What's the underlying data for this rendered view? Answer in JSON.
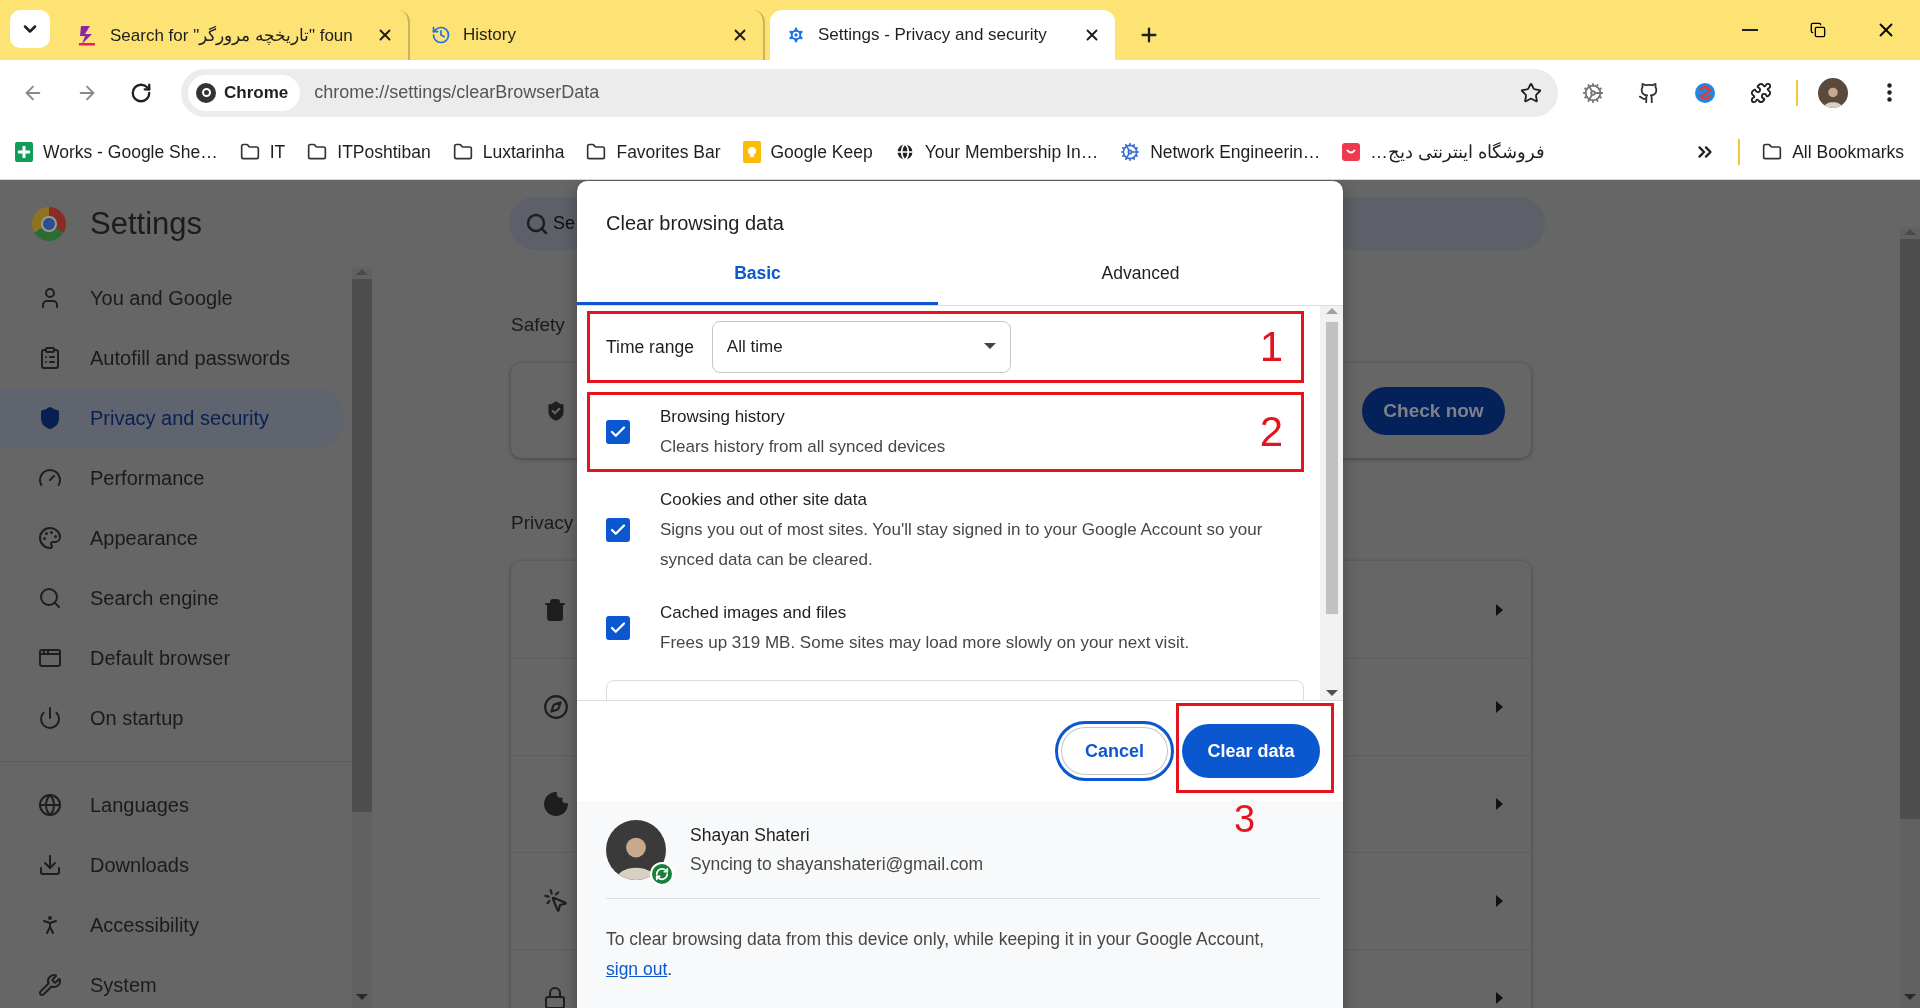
{
  "browser_tabs": [
    {
      "title": "Search for \"تاریخچه مرورگر\" foun",
      "selected": false
    },
    {
      "title": "History",
      "selected": false
    },
    {
      "title": "Settings - Privacy and security",
      "selected": true
    }
  ],
  "address_bar": {
    "chip": "Chrome",
    "url": "chrome://settings/clearBrowserData"
  },
  "bookmarks": [
    {
      "label": "Works - Google She…"
    },
    {
      "label": "IT"
    },
    {
      "label": "ITPoshtiban"
    },
    {
      "label": "Luxtarinha"
    },
    {
      "label": "Favorites Bar"
    },
    {
      "label": "Google Keep"
    },
    {
      "label": "Your Membership In…"
    },
    {
      "label": "Network Engineerin…"
    },
    {
      "label": "فروشگاه اینترنتی دیج…"
    }
  ],
  "all_bookmarks": "All Bookmarks",
  "settings": {
    "title": "Settings",
    "search_placeholder": "Se",
    "nav_groups": [
      {
        "items": [
          {
            "label": "You and Google",
            "selected": false
          },
          {
            "label": "Autofill and passwords",
            "selected": false
          },
          {
            "label": "Privacy and security",
            "selected": true
          },
          {
            "label": "Performance",
            "selected": false
          },
          {
            "label": "Appearance",
            "selected": false
          },
          {
            "label": "Search engine",
            "selected": false
          },
          {
            "label": "Default browser",
            "selected": false
          },
          {
            "label": "On startup",
            "selected": false
          }
        ]
      },
      {
        "items": [
          {
            "label": "Languages",
            "selected": false
          },
          {
            "label": "Downloads",
            "selected": false
          },
          {
            "label": "Accessibility",
            "selected": false
          },
          {
            "label": "System",
            "selected": false
          }
        ]
      }
    ],
    "safety_heading": "Safety",
    "check_button": "Check now",
    "privacy_heading": "Privacy"
  },
  "dialog": {
    "title": "Clear browsing data",
    "tabs": [
      {
        "label": "Basic",
        "selected": true
      },
      {
        "label": "Advanced",
        "selected": false
      }
    ],
    "time_range": {
      "label": "Time range",
      "value": "All time",
      "annotation": "1"
    },
    "options": [
      {
        "title": "Browsing history",
        "description": "Clears history from all synced devices",
        "checked": true,
        "annotation": "2"
      },
      {
        "title": "Cookies and other site data",
        "description": "Signs you out of most sites. You'll stay signed in to your Google Account so your synced data can be cleared.",
        "checked": true
      },
      {
        "title": "Cached images and files",
        "description": "Frees up 319 MB. Some sites may load more slowly on your next visit.",
        "checked": true
      }
    ],
    "cancel": "Cancel",
    "confirm": "Clear data",
    "confirm_annotation": "3",
    "account": {
      "name": "Shayan Shateri",
      "status": "Syncing to shayanshateri@gmail.com"
    },
    "note": "To clear browsing data from this device only, while keeping it in your Google Account, ",
    "note_link": "sign out",
    "note_end": "."
  }
}
